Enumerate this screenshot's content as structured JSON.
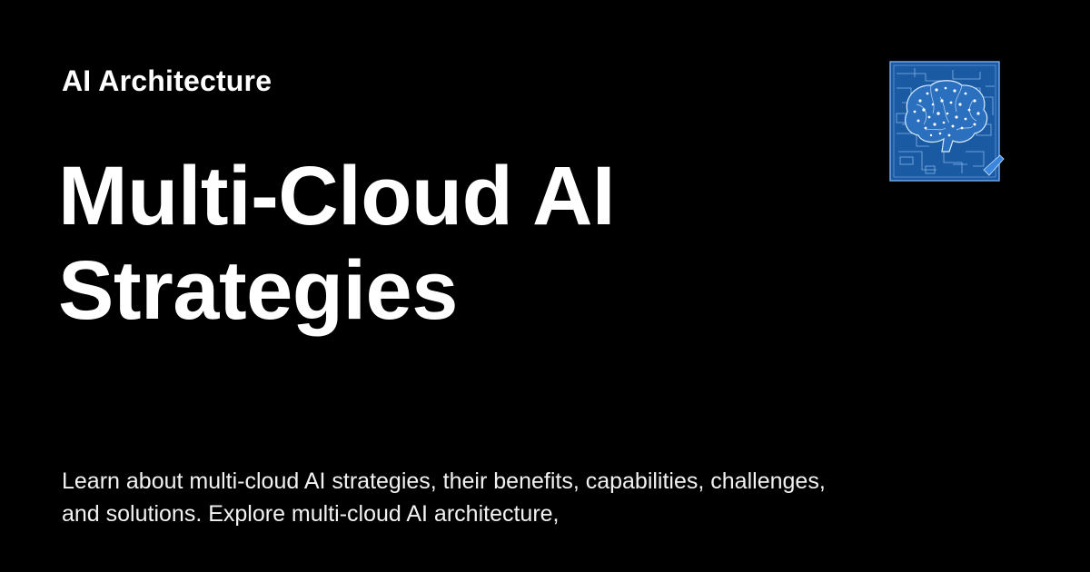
{
  "site": {
    "name": "AI Architecture"
  },
  "page": {
    "title": "Multi-Cloud AI Strategies",
    "description": "Learn about multi-cloud AI strategies, their benefits, capabilities, challenges, and solutions. Explore multi-cloud AI architecture,"
  },
  "logo": {
    "icon": "brain-blueprint-icon"
  },
  "colors": {
    "background": "#000000",
    "text": "#ffffff",
    "logo_blue": "#1d5fa8",
    "logo_line": "#9cc8ff"
  }
}
